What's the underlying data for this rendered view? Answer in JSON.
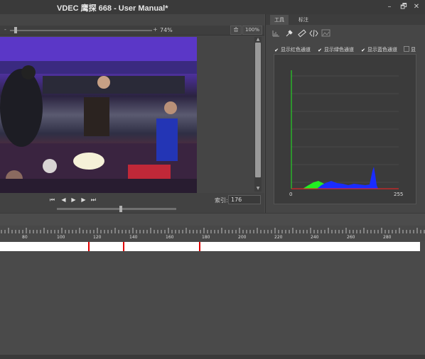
{
  "window": {
    "title": "VDEC 鹰探 668 - User Manual*"
  },
  "window_controls": {
    "minimize": "–",
    "restore": "🗗",
    "close": "✕"
  },
  "zoom": {
    "minus": "-",
    "plus": "+",
    "percent": "74%",
    "fit_label": "合",
    "hundred_label": "100%",
    "slider_level": 0.05
  },
  "playback": {
    "first": "⏮",
    "prev": "◀",
    "play": "▶",
    "next": "▶",
    "last": "⏭",
    "index_label": "索引:",
    "index_value": "176",
    "seek_level": 0.5
  },
  "right_panel": {
    "tabs": [
      {
        "label": "工具",
        "active": true
      },
      {
        "label": "标注",
        "active": false
      }
    ],
    "tools": [
      "histogram-icon",
      "eyedropper-icon",
      "ruler-icon",
      "code-icon",
      "image-icon"
    ],
    "channels": [
      {
        "label": "显示红色通道",
        "checked": true
      },
      {
        "label": "显示绿色通道",
        "checked": true
      },
      {
        "label": "显示蓝色通道",
        "checked": true
      },
      {
        "label": "显",
        "checked": false
      }
    ],
    "histogram": {
      "x_min": "0",
      "x_max": "255"
    }
  },
  "timeline": {
    "ticks": [
      "80",
      "100",
      "120",
      "140",
      "160",
      "180",
      "200",
      "220",
      "240",
      "260",
      "280"
    ],
    "markers": [
      115,
      134,
      176
    ]
  },
  "colors": {
    "accent_red": "#e00000",
    "hist_red": "#ff2020",
    "hist_green": "#22ee22",
    "hist_blue": "#1a2cff"
  }
}
